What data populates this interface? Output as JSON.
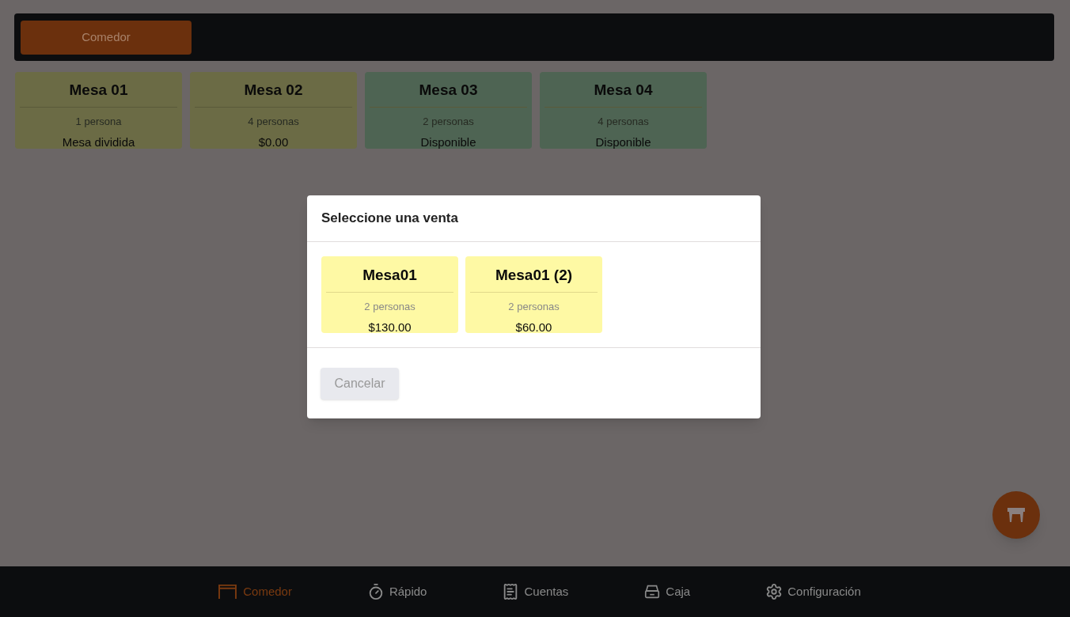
{
  "top_bar": {
    "tabs": [
      {
        "label": "Comedor",
        "selected": true
      }
    ]
  },
  "tables": [
    {
      "name": "Mesa 01",
      "people": "1 persona",
      "status_text": "Mesa dividida",
      "kind": "occupied"
    },
    {
      "name": "Mesa 02",
      "people": "4 personas",
      "status_text": "$0.00",
      "kind": "occupied"
    },
    {
      "name": "Mesa 03",
      "people": "2 personas",
      "status_text": "Disponible",
      "kind": "available"
    },
    {
      "name": "Mesa 04",
      "people": "4 personas",
      "status_text": "Disponible",
      "kind": "available"
    }
  ],
  "dialog": {
    "title": "Seleccione una venta",
    "sales": [
      {
        "name": "Mesa01",
        "people": "2 personas",
        "total": "$130.00"
      },
      {
        "name": "Mesa01 (2)",
        "people": "2 personas",
        "total": "$60.00"
      }
    ],
    "cancel_button": {
      "label": "Cancelar",
      "disabled": true
    }
  },
  "bottom_nav": [
    {
      "label": "Comedor",
      "kind": "table",
      "selected": true
    },
    {
      "label": "Rápido",
      "kind": "timer",
      "selected": false
    },
    {
      "label": "Cuentas",
      "kind": "receipt",
      "selected": false
    },
    {
      "label": "Caja",
      "kind": "register",
      "selected": false
    },
    {
      "label": "Configuración",
      "kind": "gear",
      "selected": false
    }
  ]
}
